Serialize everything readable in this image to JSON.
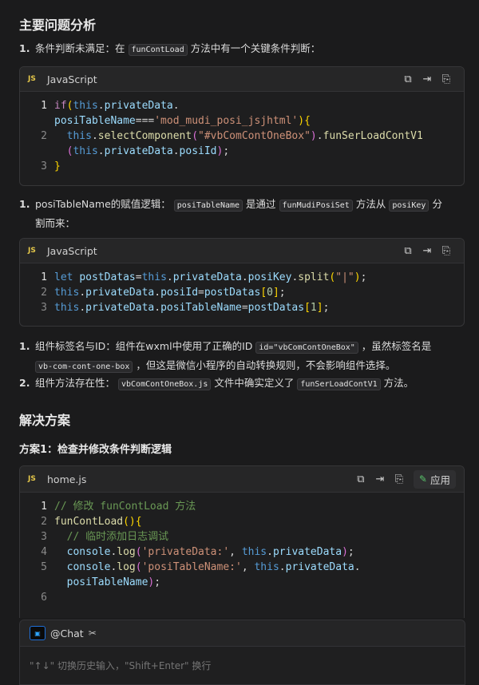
{
  "section1": {
    "title": "主要问题分析"
  },
  "item1": {
    "num": "1.",
    "text_a": "条件判断未满足：在",
    "code": "funContLoad",
    "text_b": "方法中有一个关键条件判断："
  },
  "block1": {
    "lang_icon": "JS",
    "lang": "JavaScript",
    "icons": [
      "copy-icon",
      "insert-icon",
      "apply-file-icon"
    ],
    "line_numbers": [
      "1",
      "2",
      "3"
    ]
  },
  "item2": {
    "num": "1.",
    "text_a": "posiTableName的赋值逻辑：",
    "code1": "posiTableName",
    "text_b": "是通过",
    "code2": "funMudiPosiSet",
    "text_c": "方法从",
    "code3": "posiKey",
    "text_d": "分",
    "text_e": "割而来："
  },
  "block2": {
    "lang_icon": "JS",
    "lang": "JavaScript",
    "line_numbers": [
      "1",
      "2",
      "3"
    ]
  },
  "item3": {
    "num": "1.",
    "text_a": "组件标签名与ID：组件在wxml中使用了正确的ID",
    "code1": "id=\"vbComContOneBox\"",
    "text_b": "，虽然标签名是",
    "code2": "vb-com-cont-one-box",
    "text_c": "，但这是微信小程序的自动转换规则，不会影响组件选择。"
  },
  "item4": {
    "num": "2.",
    "text_a": "组件方法存在性：",
    "code1": "vbComContOneBox.js",
    "text_b": "文件中确实定义了",
    "code2": "funSerLoadContV1",
    "text_c": "方法。"
  },
  "section2": {
    "title": "解决方案"
  },
  "section3": {
    "title": "方案1：检查并修改条件判断逻辑"
  },
  "block3": {
    "lang_icon": "JS",
    "lang": "home.js",
    "apply_label": "应用",
    "line_numbers": [
      "1",
      "2",
      "3",
      "4",
      "5",
      "6"
    ]
  },
  "chat": {
    "mention": "@Chat",
    "placeholder": "\"↑↓\" 切换历史输入，\"Shift+Enter\" 换行"
  },
  "colors": {
    "background": "#1b1b1c",
    "code_bg": "#1e1e1f",
    "keyword": "#c586c0",
    "function": "#dcdcaa",
    "string": "#ce9178",
    "comment": "#6a9955",
    "accent_green": "#58c36a"
  }
}
